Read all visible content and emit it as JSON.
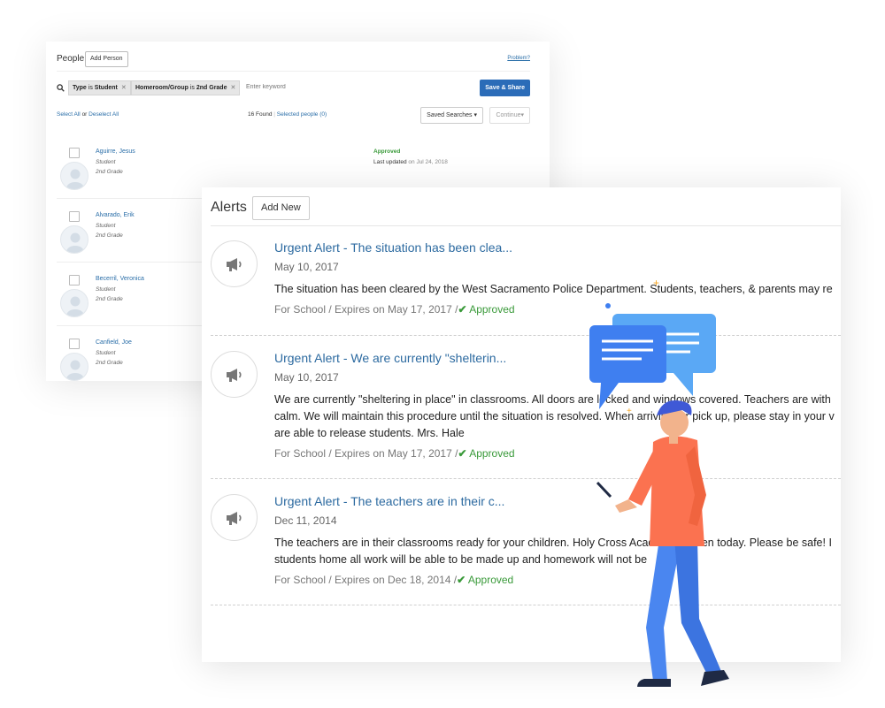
{
  "people_panel": {
    "title": "People",
    "add_person_label": "Add Person",
    "problem_link": "Problem?",
    "filters": [
      {
        "field": "Type",
        "op": "is",
        "value": "Student"
      },
      {
        "field": "Homeroom/Group",
        "op": "is",
        "value": "2nd Grade"
      }
    ],
    "keyword_placeholder": "Enter keyword",
    "save_share_label": "Save & Share",
    "select_all_label": "Select All",
    "or_label": "or",
    "deselect_all_label": "Deselect All",
    "found_text": "16 Found",
    "selected_text": "Selected people (0)",
    "saved_searches_label": "Saved Searches ▾",
    "continue_label": "Continue▾",
    "people": [
      {
        "name": "Aguirre, Jesus",
        "role": "Student",
        "grade": "2nd Grade",
        "status": "Approved",
        "updated_label": "Last updated",
        "updated_date": "on Jul 24, 2018"
      },
      {
        "name": "Alvarado, Erik",
        "role": "Student",
        "grade": "2nd Grade",
        "status": "",
        "updated_label": "",
        "updated_date": ""
      },
      {
        "name": "Becerril, Veronica",
        "role": "Student",
        "grade": "2nd Grade",
        "status": "",
        "updated_label": "",
        "updated_date": ""
      },
      {
        "name": "Canfield, Joe",
        "role": "Student",
        "grade": "2nd Grade",
        "status": "",
        "updated_label": "",
        "updated_date": ""
      }
    ]
  },
  "alerts_panel": {
    "title": "Alerts",
    "add_new_label": "Add New",
    "alerts": [
      {
        "title": "Urgent Alert - The situation has been clea...",
        "date": "May 10, 2017",
        "body_lines": [
          "The situation has been cleared by the West Sacramento Police Department. Students, teachers, & parents may re"
        ],
        "meta": "For School / Expires on May 17, 2017 /",
        "status": "Approved"
      },
      {
        "title": "Urgent Alert - We are currently \"shelterin...",
        "date": "May 10, 2017",
        "body_lines": [
          "We are currently \"sheltering in place\" in classrooms. All doors are locked and windows covered. Teachers are with",
          "calm. We will maintain this procedure until the situation is resolved. When arriving for pick up, please stay in your v",
          "are able to release students. Mrs. Hale"
        ],
        "meta": "For School / Expires on May 17, 2017 /",
        "status": "Approved"
      },
      {
        "title": "Urgent Alert - The teachers are in their c...",
        "date": "Dec 11, 2014",
        "body_lines": [
          "The teachers are in their classrooms ready for your children. Holy Cross Academy is open today. Please be safe! I",
          "students home all work will be able to be made up and homework will not be"
        ],
        "meta": "For School / Expires on Dec 18, 2014 /",
        "status": "Approved"
      }
    ]
  },
  "colors": {
    "link_blue": "#2c6aa0",
    "primary_button": "#2b6cb8",
    "approved_green": "#3a9a3a",
    "bubble_dark": "#3f7ff0",
    "bubble_light": "#5aa8f5",
    "shirt": "#fb7250",
    "pants": "#4a86f0"
  },
  "icons": [
    "search-icon",
    "megaphone-icon",
    "chevron-down-icon",
    "close-icon",
    "checkmark-icon",
    "avatar-icon",
    "chat-bubbles-icon"
  ]
}
